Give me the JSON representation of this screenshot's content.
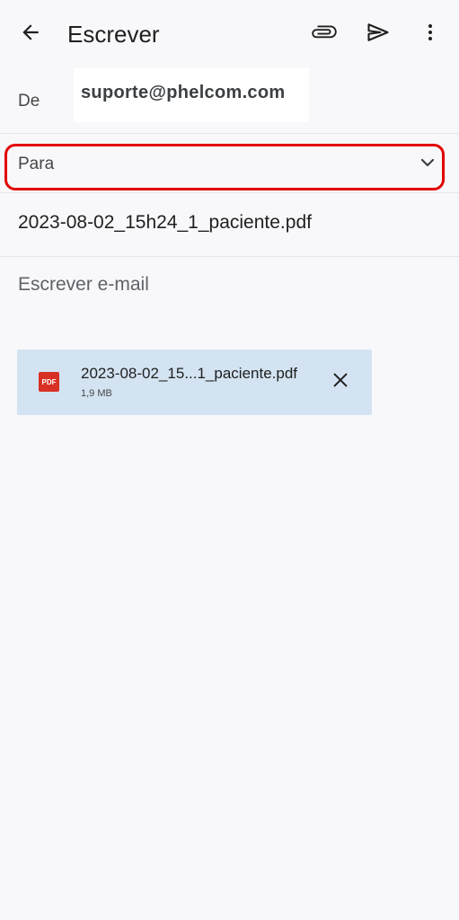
{
  "header": {
    "title": "Escrever",
    "icons": {
      "back": "arrow-back-icon",
      "attach": "paperclip-icon",
      "send": "send-icon",
      "more": "more-vert-icon"
    }
  },
  "from": {
    "label": "De",
    "value": "suporte@phelcom.com"
  },
  "to": {
    "label": "Para",
    "highlight_color": "#e10000",
    "icon": "chevron-down-icon"
  },
  "subject": {
    "value": "2023-08-02_15h24_1_paciente.pdf"
  },
  "body": {
    "placeholder": "Escrever e-mail"
  },
  "attachment": {
    "badge": "PDF",
    "name": "2023-08-02_15...1_paciente.pdf",
    "size": "1,9 MB",
    "background": "#d3e3f2",
    "icons": {
      "file": "pdf-file-icon",
      "remove": "close-icon"
    }
  }
}
